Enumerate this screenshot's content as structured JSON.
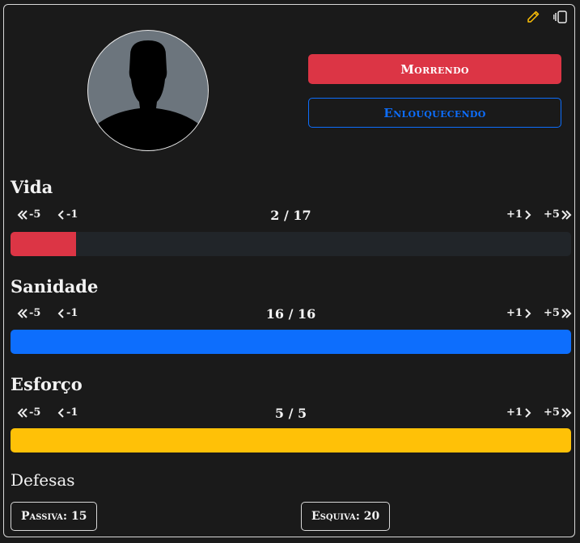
{
  "colors": {
    "background": "#1a1a1a",
    "danger": "#dc3545",
    "primary": "#0d6efd",
    "warning": "#ffc107",
    "track": "#212529",
    "edit_icon": "#ffc107"
  },
  "header_icons": [
    {
      "name": "pencil-icon",
      "color": "#ffc107"
    },
    {
      "name": "toggle-view-icon",
      "color": "#e9e9e9"
    }
  ],
  "avatar": {
    "icon": "person-silhouette-icon"
  },
  "status_buttons": {
    "dying": "Morrendo",
    "insane": "Enlouquecendo"
  },
  "controls": {
    "minus5": "-5",
    "minus1": "-1",
    "plus1": "+1",
    "plus5": "+5"
  },
  "stats": {
    "vida": {
      "title": "Vida",
      "current": 2,
      "max": 17,
      "display": "2 / 17",
      "fill_fraction": 0.1176,
      "color": "#dc3545"
    },
    "sanidade": {
      "title": "Sanidade",
      "current": 16,
      "max": 16,
      "display": "16 / 16",
      "fill_fraction": 1.0,
      "color": "#0d6efd"
    },
    "esforco": {
      "title": "Esforço",
      "current": 5,
      "max": 5,
      "display": "5 / 5",
      "fill_fraction": 1.0,
      "color": "#ffc107"
    }
  },
  "defesas": {
    "title": "Defesas",
    "passiva": "Passiva: 15",
    "esquiva": "Esquiva: 20"
  }
}
